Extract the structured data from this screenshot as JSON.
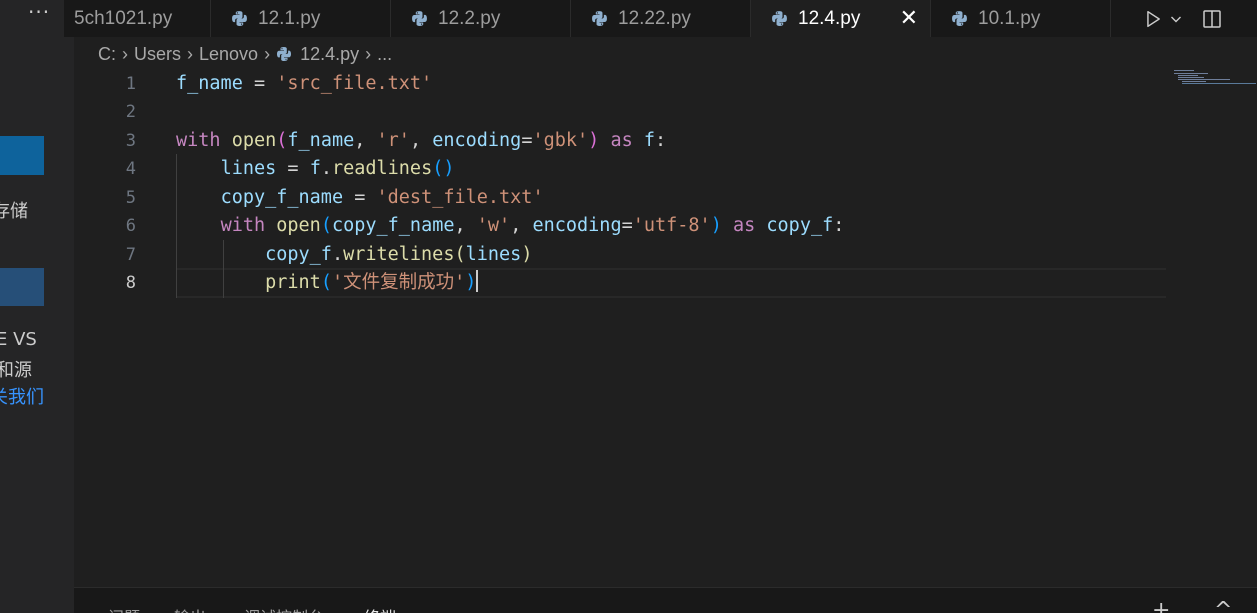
{
  "sidebar": {
    "more_label": "···",
    "text_1": "存储",
    "text_2": "E VS",
    "text_3": "和源",
    "text_4": "关我们"
  },
  "tabs": [
    {
      "label": "5ch1021.py",
      "active": false
    },
    {
      "label": "12.1.py",
      "active": false
    },
    {
      "label": "12.2.py",
      "active": false
    },
    {
      "label": "12.22.py",
      "active": false
    },
    {
      "label": "12.4.py",
      "active": true
    },
    {
      "label": "10.1.py",
      "active": false
    }
  ],
  "tab_close_glyph": "✕",
  "breadcrumb": {
    "drive": "C:",
    "folder_1": "Users",
    "folder_2": "Lenovo",
    "file": "12.4.py",
    "more": "..."
  },
  "editor": {
    "line_numbers": [
      "1",
      "2",
      "3",
      "4",
      "5",
      "6",
      "7",
      "8"
    ],
    "current_line": 8,
    "tokens": {
      "l1_var": "f_name",
      "l1_eq": " = ",
      "l1_str": "'src_file.txt'",
      "l3_with": "with",
      "l3_open": "open",
      "l3_lp": "(",
      "l3_arg": "f_name",
      "l3_c1": ", ",
      "l3_mode": "'r'",
      "l3_c2": ", ",
      "l3_kw": "encoding",
      "l3_eq": "=",
      "l3_enc": "'gbk'",
      "l3_rp": ")",
      "l3_as": "as",
      "l3_f": "f",
      "l3_colon": ":",
      "l4_var": "lines",
      "l4_eq": " = ",
      "l4_obj": "f",
      "l4_dot": ".",
      "l4_fn": "readlines",
      "l4_parens": "()",
      "l5_var": "copy_f_name",
      "l5_eq": " = ",
      "l5_str": "'dest_file.txt'",
      "l6_with": "with",
      "l6_open": "open",
      "l6_lp": "(",
      "l6_arg": "copy_f_name",
      "l6_c1": ", ",
      "l6_mode": "'w'",
      "l6_c2": ", ",
      "l6_kw": "encoding",
      "l6_eq": "=",
      "l6_enc": "'utf-8'",
      "l6_rp": ")",
      "l6_as": "as",
      "l6_f": "copy_f",
      "l6_colon": ":",
      "l7_obj": "copy_f",
      "l7_dot": ".",
      "l7_fn": "writelines",
      "l7_lp": "(",
      "l7_arg": "lines",
      "l7_rp": ")",
      "l8_fn": "print",
      "l8_lp": "(",
      "l8_str": "'文件复制成功'",
      "l8_rp": ")"
    }
  },
  "panel_tabs": [
    "问题",
    "输出",
    "调试控制台",
    "终端"
  ],
  "panel_actions": [
    "+",
    "^"
  ],
  "colors": {
    "keyword": "#c586c0",
    "function": "#dcdcaa",
    "variable": "#9cdcfe",
    "string": "#ce9178",
    "accent_button": "#0e639c",
    "link": "#3794ff"
  }
}
